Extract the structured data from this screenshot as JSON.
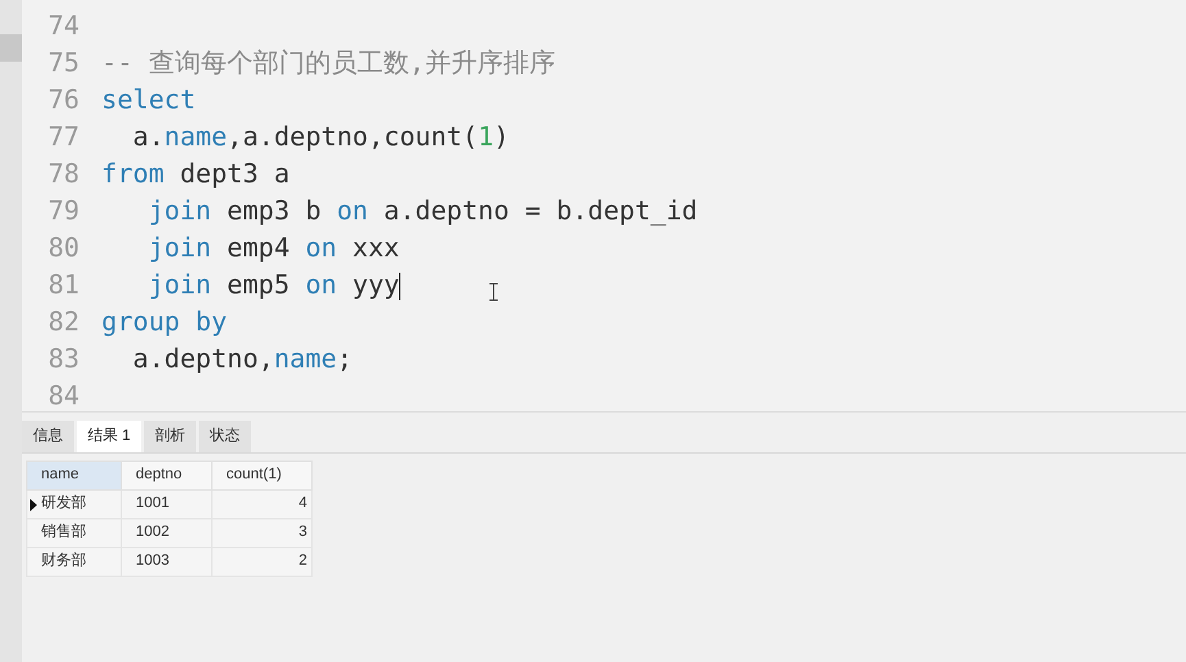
{
  "editor": {
    "lines": [
      {
        "number": "74"
      },
      {
        "number": "75",
        "tokens": [
          {
            "kind": "comment",
            "text": "-- 查询每个部门的员工数,并升序排序"
          }
        ]
      },
      {
        "number": "76",
        "tokens": [
          {
            "kind": "keyword",
            "text": "select"
          }
        ]
      },
      {
        "number": "77",
        "tokens": [
          {
            "kind": "plain",
            "text": "  a."
          },
          {
            "kind": "keyword",
            "text": "name"
          },
          {
            "kind": "plain",
            "text": ",a.deptno,count("
          },
          {
            "kind": "number",
            "text": "1"
          },
          {
            "kind": "plain",
            "text": ")"
          }
        ]
      },
      {
        "number": "78",
        "tokens": [
          {
            "kind": "keyword",
            "text": "from"
          },
          {
            "kind": "plain",
            "text": " dept3 a"
          }
        ]
      },
      {
        "number": "79",
        "tokens": [
          {
            "kind": "keyword",
            "text": "   join"
          },
          {
            "kind": "plain",
            "text": " emp3 b "
          },
          {
            "kind": "keyword",
            "text": "on"
          },
          {
            "kind": "plain",
            "text": " a.deptno = b.dept_id"
          }
        ]
      },
      {
        "number": "80",
        "tokens": [
          {
            "kind": "keyword",
            "text": "   join"
          },
          {
            "kind": "plain",
            "text": " emp4 "
          },
          {
            "kind": "keyword",
            "text": "on"
          },
          {
            "kind": "plain",
            "text": " xxx"
          }
        ]
      },
      {
        "number": "81",
        "cursor": true,
        "tokens": [
          {
            "kind": "keyword",
            "text": "   join"
          },
          {
            "kind": "plain",
            "text": " emp5 "
          },
          {
            "kind": "keyword",
            "text": "on"
          },
          {
            "kind": "plain",
            "text": " yyy"
          }
        ]
      },
      {
        "number": "82",
        "tokens": [
          {
            "kind": "keyword",
            "text": "group by"
          }
        ]
      },
      {
        "number": "83",
        "tokens": [
          {
            "kind": "plain",
            "text": "  a.deptno,"
          },
          {
            "kind": "keyword",
            "text": "name"
          },
          {
            "kind": "plain",
            "text": ";"
          }
        ]
      },
      {
        "number": "84"
      }
    ]
  },
  "result_tabs": [
    {
      "label": "信息",
      "selected": false
    },
    {
      "label": "结果 1",
      "selected": true
    },
    {
      "label": "剖析",
      "selected": false
    },
    {
      "label": "状态",
      "selected": false
    }
  ],
  "table": {
    "columns": [
      {
        "label": "name",
        "selected": true
      },
      {
        "label": "deptno",
        "selected": false
      },
      {
        "label": "count(1)",
        "selected": false
      }
    ],
    "rows": [
      {
        "selected": true,
        "cells": [
          "研发部",
          "1001",
          "4"
        ]
      },
      {
        "selected": false,
        "cells": [
          "销售部",
          "1002",
          "3"
        ]
      },
      {
        "selected": false,
        "cells": [
          "财务部",
          "1003",
          "2"
        ]
      }
    ]
  }
}
